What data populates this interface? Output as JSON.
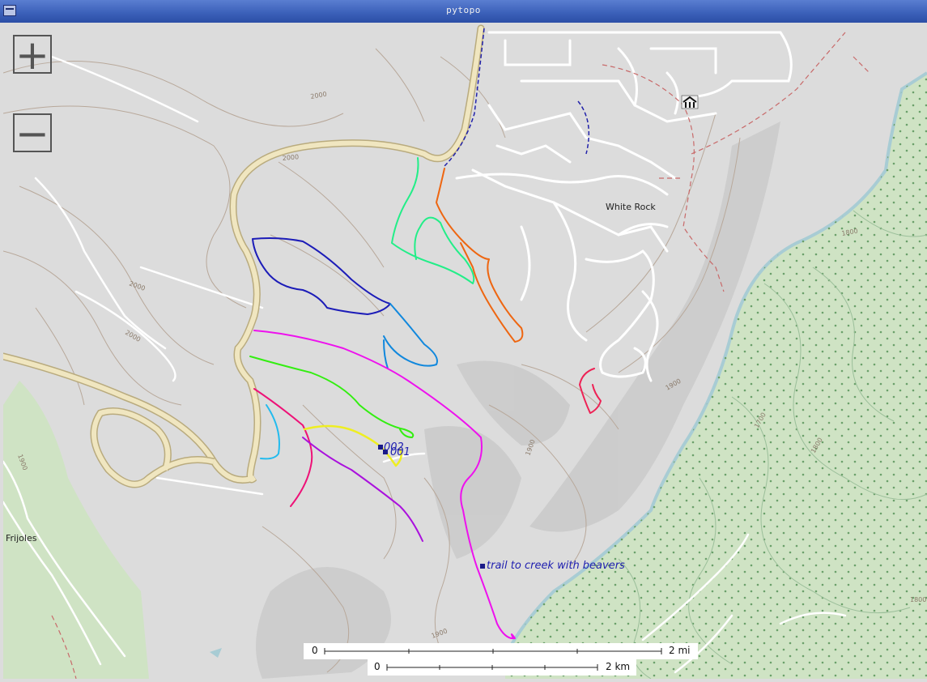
{
  "window": {
    "title": "pytopo"
  },
  "controls": {
    "zoom_in": "+",
    "zoom_out": "−"
  },
  "places": {
    "white_rock": "White Rock",
    "frijoles": "Frijoles"
  },
  "waypoints": {
    "w001": "001",
    "w002": "002",
    "creek": "trail to creek with beavers"
  },
  "scale": {
    "miles": {
      "start": "0",
      "end": "2 mi"
    },
    "km": {
      "start": "0",
      "end": "2 km"
    }
  },
  "contour_labels": [
    "2000",
    "2000",
    "2000",
    "2000",
    "1900",
    "1900",
    "1800",
    "1800",
    "1700",
    "1800",
    "1900",
    "1900"
  ],
  "colors": {
    "terrain": "#dcdcdc",
    "forest": "#cfe3c4",
    "road_major": "#f0e6c0",
    "track_darkblue": "#1c1cb8",
    "track_magenta": "#ee11ee",
    "track_orange": "#ee6611",
    "track_mint": "#22ee88",
    "track_green": "#33ee11",
    "track_lightblue": "#1188dd",
    "track_pink": "#ee1177",
    "track_purple": "#aa11dd",
    "track_yellow": "#eeee22",
    "track_cyan": "#22bbee",
    "track_red": "#ee2255"
  }
}
